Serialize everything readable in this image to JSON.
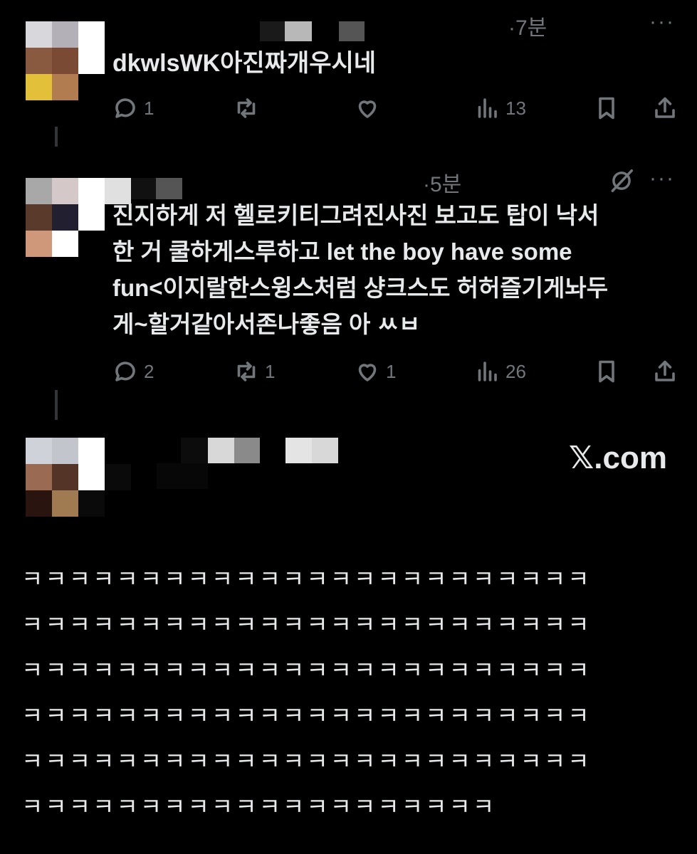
{
  "posts": [
    {
      "time": "·7분",
      "text": "dkwlsWK아진짜개우시네",
      "stats": {
        "reply": "1",
        "retweet": "",
        "like": "",
        "views": "13"
      }
    },
    {
      "time": "·5분",
      "text_lines": [
        "진지하게 저 헬로키티그려진사진 보고도 탑이 낙서",
        "한 거 쿨하게스루하고 let the boy have some",
        "fun<이지랄한스윙스처럼 샹크스도 허허즐기게놔두",
        "게~할거같아서존나좋음 아 ㅆㅂ"
      ],
      "stats": {
        "reply": "2",
        "retweet": "1",
        "like": "1",
        "views": "26"
      }
    }
  ],
  "watermark": "𝕏.com",
  "laugh_lines": [
    "ㅋㅋㅋㅋㅋㅋㅋㅋㅋㅋㅋㅋㅋㅋㅋㅋㅋㅋㅋㅋㅋㅋㅋㅋ",
    "ㅋㅋㅋㅋㅋㅋㅋㅋㅋㅋㅋㅋㅋㅋㅋㅋㅋㅋㅋㅋㅋㅋㅋㅋ",
    "ㅋㅋㅋㅋㅋㅋㅋㅋㅋㅋㅋㅋㅋㅋㅋㅋㅋㅋㅋㅋㅋㅋㅋㅋ",
    "ㅋㅋㅋㅋㅋㅋㅋㅋㅋㅋㅋㅋㅋㅋㅋㅋㅋㅋㅋㅋㅋㅋㅋㅋ",
    "ㅋㅋㅋㅋㅋㅋㅋㅋㅋㅋㅋㅋㅋㅋㅋㅋㅋㅋㅋㅋㅋㅋㅋㅋ",
    "ㅋㅋㅋㅋㅋㅋㅋㅋㅋㅋㅋㅋㅋㅋㅋㅋㅋㅋㅋㅋ"
  ],
  "icons": [
    "reply-icon",
    "retweet-icon",
    "like-icon",
    "views-icon",
    "bookmark-icon",
    "share-icon",
    "more-icon",
    "grok-icon"
  ],
  "colors": {
    "background": "#000000",
    "text": "#e7e9ea",
    "muted": "#71767b"
  }
}
